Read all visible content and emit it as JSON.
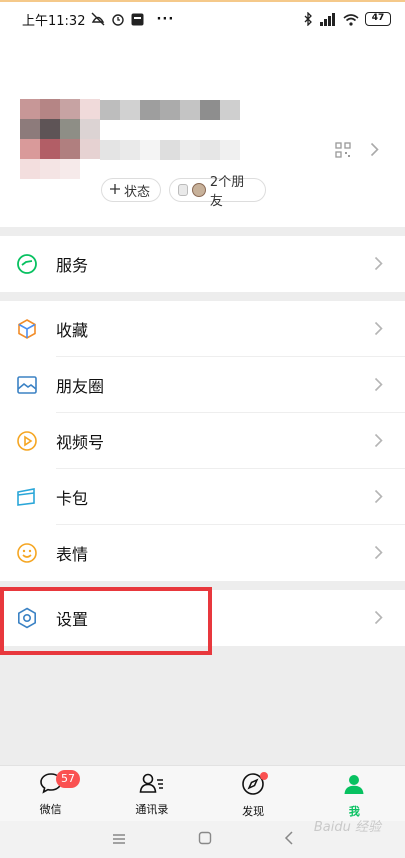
{
  "status_bar": {
    "time": "上午11:32",
    "battery": "47",
    "more": "···"
  },
  "profile": {
    "status_pill": "状态",
    "friends_pill": "2个朋友"
  },
  "menu": {
    "group1": [
      {
        "label": "服务",
        "icon": "service-icon"
      }
    ],
    "group2": [
      {
        "label": "收藏",
        "icon": "favorites-icon"
      },
      {
        "label": "朋友圈",
        "icon": "moments-icon"
      },
      {
        "label": "视频号",
        "icon": "channels-icon"
      },
      {
        "label": "卡包",
        "icon": "cards-icon"
      },
      {
        "label": "表情",
        "icon": "stickers-icon"
      }
    ],
    "group3": [
      {
        "label": "设置",
        "icon": "settings-icon"
      }
    ]
  },
  "tabbar": {
    "tabs": [
      {
        "label": "微信",
        "icon": "chat-icon",
        "badge": "57"
      },
      {
        "label": "通讯录",
        "icon": "contacts-icon"
      },
      {
        "label": "发现",
        "icon": "discover-icon"
      },
      {
        "label": "我",
        "icon": "me-icon",
        "active": true
      }
    ]
  },
  "watermark": "Baidu 经验",
  "colors": {
    "accent_green": "#07c160",
    "badge_red": "#fa5151",
    "highlight_red": "#e8383d"
  }
}
